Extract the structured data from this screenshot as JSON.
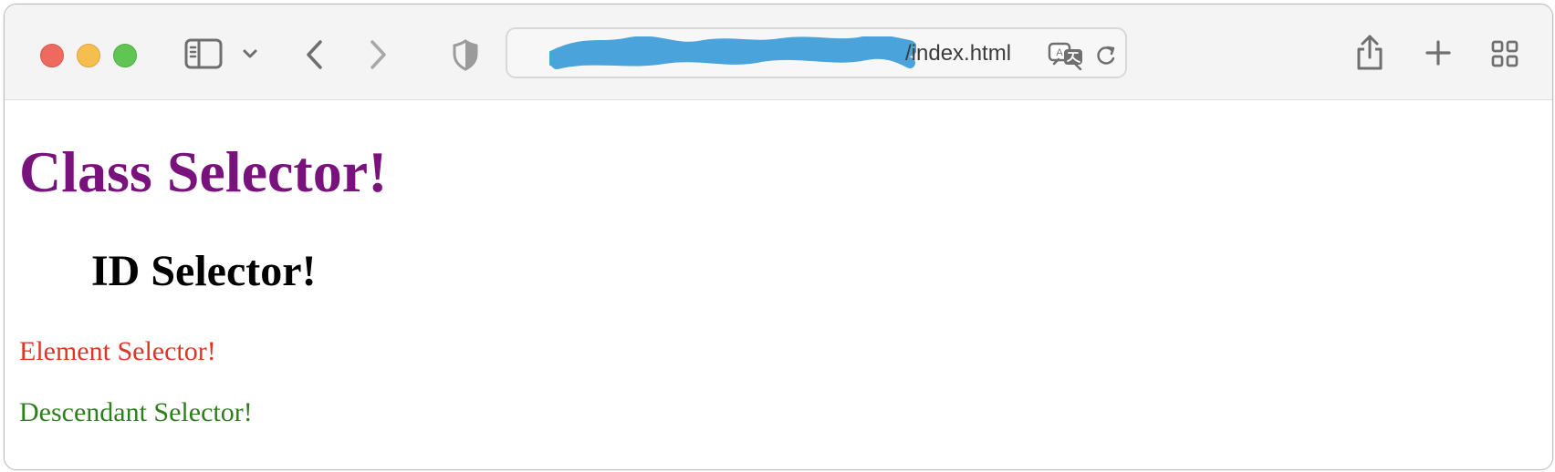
{
  "browser": {
    "url_visible": "/index.html",
    "icons": {
      "sidebar": "sidebar-icon",
      "sidebar_menu": "chevron-down-icon",
      "back": "chevron-left-icon",
      "forward": "chevron-right-icon",
      "privacy": "shield-icon",
      "redaction": "blue-redaction-mark",
      "translate": "translate-icon",
      "reload": "reload-icon",
      "share": "share-icon",
      "new_tab": "plus-icon",
      "tab_overview": "grid-icon"
    },
    "colors": {
      "close": "#ee6a5f",
      "minimize": "#f5be4f",
      "maximize": "#61c554",
      "redaction": "#4aa3db",
      "toolbar": "#f5f4f4",
      "icon_gray": "#6f6f6f"
    }
  },
  "page": {
    "class_selector": "Class Selector!",
    "id_selector": "ID Selector!",
    "element_selector": "Element Selector!",
    "descendant_selector": "Descendant Selector!",
    "colors": {
      "class_selector": "#7a127e",
      "id_selector": "#000000",
      "element_selector": "#e03424",
      "descendant_selector": "#2f7e1d",
      "background": "#ffffff"
    }
  }
}
